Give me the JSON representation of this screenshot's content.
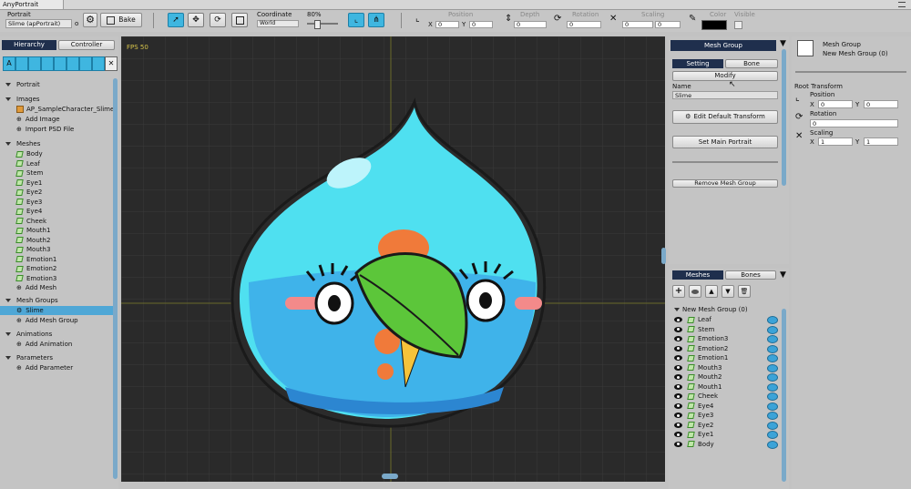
{
  "window": {
    "title": "AnyPortrait"
  },
  "toolbar": {
    "portrait_label": "Portrait",
    "portrait_value": "Slime (apPortrait)",
    "portrait_suffix": "o",
    "bake_label": "Bake",
    "coordinate_label": "Coordinate",
    "coordinate_value": "World",
    "zoom_value": "80%",
    "position_label": "Position",
    "depth_label": "Depth",
    "rotation_label": "Rotation",
    "scaling_label": "Scaling",
    "color_label": "Color",
    "visible_label": "Visible",
    "pos_x": "0",
    "pos_y": "0",
    "depth_value": "0",
    "rotation_value": "0",
    "scale_x": "0",
    "scale_y": "0",
    "x_label": "X",
    "y_label": "Y"
  },
  "left_panel": {
    "tabs": [
      "Hierarchy",
      "Controller"
    ],
    "sections": {
      "portrait": "Portrait",
      "images": "Images",
      "image_items": [
        "AP_SampleCharacter_Slime"
      ],
      "add_image": "Add Image",
      "import_psd": "Import PSD File",
      "meshes": "Meshes",
      "mesh_items": [
        "Body",
        "Leaf",
        "Stem",
        "Eye1",
        "Eye2",
        "Eye3",
        "Eye4",
        "Cheek",
        "Mouth1",
        "Mouth2",
        "Mouth3",
        "Emotion1",
        "Emotion2",
        "Emotion3"
      ],
      "add_mesh": "Add Mesh",
      "mesh_groups": "Mesh Groups",
      "mesh_group_items": [
        "Slime"
      ],
      "add_mesh_group": "Add Mesh Group",
      "animations": "Animations",
      "add_animation": "Add Animation",
      "parameters": "Parameters",
      "add_parameter": "Add Parameter"
    }
  },
  "canvas": {
    "fps": "FPS 50"
  },
  "mesh_group_panel": {
    "header": "Mesh Group",
    "tabs": [
      "Setting",
      "Bone"
    ],
    "modify": "Modify",
    "name_label": "Name",
    "name_value": "Slime",
    "edit_default_transform": "Edit Default Transform",
    "set_main_portrait": "Set Main Portrait",
    "remove_mesh_group": "Remove Mesh Group"
  },
  "meshes_panel": {
    "tabs": [
      "Meshes",
      "Bones"
    ],
    "group_label": "New Mesh Group (0)",
    "items": [
      "Leaf",
      "Stem",
      "Emotion3",
      "Emotion2",
      "Emotion1",
      "Mouth3",
      "Mouth2",
      "Mouth1",
      "Cheek",
      "Eye4",
      "Eye3",
      "Eye2",
      "Eye1",
      "Body"
    ]
  },
  "inspector": {
    "title": "Mesh Group",
    "subtitle": "New Mesh Group (0)",
    "root_transform": "Root Transform",
    "position_label": "Position",
    "rotation_label": "Rotation",
    "scaling_label": "Scaling",
    "pos_x": "0",
    "pos_y": "0",
    "rotation_value": "0",
    "scale_x": "1",
    "scale_y": "1",
    "x_label": "X",
    "y_label": "Y"
  },
  "colors": {
    "accent": "#3fb6e0",
    "header": "#1f2f4d",
    "canvas_bg": "#2a2a2a",
    "slime": "#4fe0f0"
  }
}
